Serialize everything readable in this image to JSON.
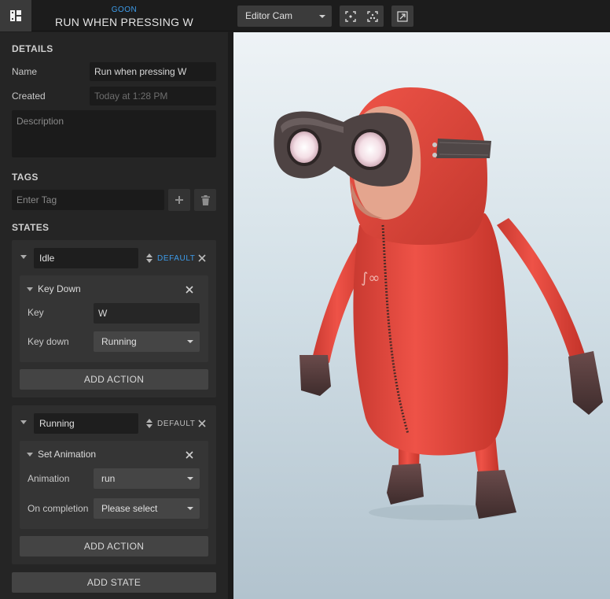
{
  "header": {
    "subtitle": "GOON",
    "title": "RUN WHEN PRESSING W",
    "camera_select": "Editor Cam"
  },
  "details": {
    "section_title": "DETAILS",
    "name_label": "Name",
    "name_value": "Run when pressing W",
    "created_label": "Created",
    "created_value": "Today at 1:28 PM",
    "description_placeholder": "Description"
  },
  "tags": {
    "section_title": "TAGS",
    "input_placeholder": "Enter Tag"
  },
  "states": {
    "section_title": "STATES",
    "items": [
      {
        "name": "Idle",
        "default_label": "DEFAULT",
        "is_default": true,
        "action": {
          "title": "Key Down",
          "fields": [
            {
              "label": "Key",
              "value": "W",
              "type": "text"
            },
            {
              "label": "Key down",
              "value": "Running",
              "type": "select"
            }
          ]
        },
        "add_action_label": "ADD ACTION"
      },
      {
        "name": "Running",
        "default_label": "DEFAULT",
        "is_default": false,
        "action": {
          "title": "Set Animation",
          "fields": [
            {
              "label": "Animation",
              "value": "run",
              "type": "select"
            },
            {
              "label": "On completion",
              "value": "Please select",
              "type": "select"
            }
          ]
        },
        "add_action_label": "ADD ACTION"
      }
    ],
    "add_state_label": "ADD STATE"
  },
  "colors": {
    "accent_blue": "#3d9be9",
    "panel_bg": "#252525",
    "character_suit": "#e5493e"
  },
  "icons": {
    "logo": "app-logo-icon",
    "tool_1": "frame-selection-icon",
    "tool_2": "frame-all-icon",
    "tool_3": "fullscreen-icon",
    "add_tag": "plus-icon",
    "delete_tag": "trash-icon"
  }
}
